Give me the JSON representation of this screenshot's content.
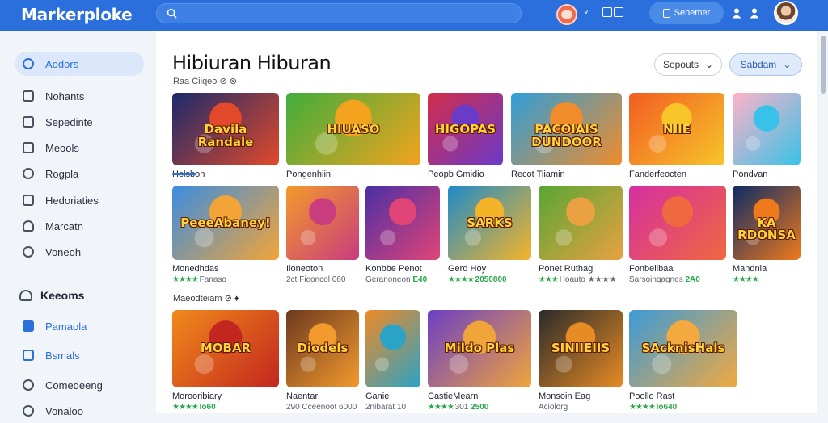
{
  "app": {
    "logo": "Markerploke"
  },
  "search": {
    "placeholder": ""
  },
  "topbar": {
    "chevron": "˅",
    "button_label": "Sehemer"
  },
  "sidebar": {
    "items": [
      {
        "label": "Aodors"
      },
      {
        "label": "Nohants"
      },
      {
        "label": "Sepedinte"
      },
      {
        "label": "Meools"
      },
      {
        "label": "Rogpla"
      },
      {
        "label": "Hedoriaties"
      },
      {
        "label": "Marcatn"
      },
      {
        "label": "Voneoh"
      }
    ],
    "section2_title": "Keeoms",
    "section2_items": [
      {
        "label": "Pamaola"
      },
      {
        "label": "Bsmals"
      },
      {
        "label": "Comedeeng"
      },
      {
        "label": "Vonaloo"
      }
    ]
  },
  "main": {
    "title": "Hibiuran Hiburan",
    "subtitle": "Raa Ciiqeo ⊘ ⊗",
    "dropdown1": "Sepouts",
    "dropdown2": "Sabdam",
    "row3_label": "Maeodteiam ⊘ ♦"
  },
  "games": [
    {
      "title": "Davila\nRandale",
      "name": "Helsbon",
      "meta": "",
      "colors": [
        "#1a2a6b",
        "#e2492a"
      ]
    },
    {
      "title": "HIUASO",
      "name": "Pongenhiin",
      "meta": "",
      "colors": [
        "#3fae3d",
        "#f3a21d"
      ]
    },
    {
      "title": "HIGOPAS",
      "name": "Peopb Gmidio",
      "meta": "",
      "colors": [
        "#d32d4a",
        "#6a3ac9"
      ]
    },
    {
      "title": "PACOIAIS\nDUNDOOR",
      "name": "Recot Tiiamin",
      "meta": "",
      "colors": [
        "#2e9ed9",
        "#f08c2a"
      ]
    },
    {
      "title": "NIIE",
      "name": "Fanderfeocten",
      "meta": "",
      "colors": [
        "#f25c22",
        "#f7c52a"
      ]
    },
    {
      "title": "",
      "name": "Pondvan",
      "meta": "",
      "colors": [
        "#ffb2c8",
        "#38c2e8"
      ]
    },
    {
      "title": "PeeeAbaney!",
      "name": "Monedhdas",
      "meta_stars": "★★★★",
      "meta": "Fanaso",
      "colors": [
        "#3b8de0",
        "#f2a438"
      ]
    },
    {
      "title": "",
      "name": "Iloneoton",
      "meta": "2ct Fieoncol 060",
      "colors": [
        "#f39a2b",
        "#c93c7e"
      ]
    },
    {
      "title": "",
      "name": "Konbbe Penot",
      "meta": "Geranoneon",
      "meta_pts": "E40",
      "colors": [
        "#4a2fa6",
        "#e14476"
      ]
    },
    {
      "title": "SARKS",
      "name": "Gerd Hoy",
      "meta_stars": "★★★★",
      "meta": "",
      "meta_pts": "2050800",
      "colors": [
        "#1e8bc9",
        "#f5b427"
      ]
    },
    {
      "title": "",
      "name": "Ponet Ruthag",
      "meta_stars": "★★★",
      "meta": "Hoauto ★★★★",
      "colors": [
        "#57a634",
        "#e9a142"
      ]
    },
    {
      "title": "",
      "name": "Fonbelibaa",
      "meta": "Sarsoingagnes",
      "meta_pts": "2A0",
      "colors": [
        "#d62ea1",
        "#f0683f"
      ]
    },
    {
      "title": "KA\nRDONSA",
      "name": "Mandnia",
      "meta_stars": "★★★★",
      "meta": "",
      "colors": [
        "#0d2a66",
        "#ef7a1b"
      ]
    },
    {
      "title": "MOBAR",
      "name": "Morooribiary",
      "meta_stars": "★★★★",
      "meta": "",
      "meta_pts": "Io60",
      "colors": [
        "#f08a1b",
        "#c3261f"
      ]
    },
    {
      "title": "Diodels",
      "name": "Naentar",
      "meta": "290 Cceenoot 6000",
      "colors": [
        "#6d3a1f",
        "#f39a2e"
      ]
    },
    {
      "title": "",
      "name": "Ganie",
      "meta": "2nibarat 10",
      "colors": [
        "#ef8a24",
        "#2aa3c6"
      ]
    },
    {
      "title": "Mildo Plas",
      "name": "CastieMearn",
      "meta": "301",
      "meta_stars": "★★★★",
      "meta_pts": "2500",
      "colors": [
        "#6b3fc6",
        "#f0a43a"
      ]
    },
    {
      "title": "SINIIEIIS",
      "name": "Monsoin Eag",
      "meta": "Aciolorg",
      "colors": [
        "#2a2a2a",
        "#e78b24"
      ]
    },
    {
      "title": "SAcknisHals",
      "name": "Poollo Rast",
      "meta_stars": "★★★★",
      "meta": "",
      "meta_pts": "Io640",
      "colors": [
        "#3a9ad8",
        "#f2a940"
      ]
    }
  ]
}
